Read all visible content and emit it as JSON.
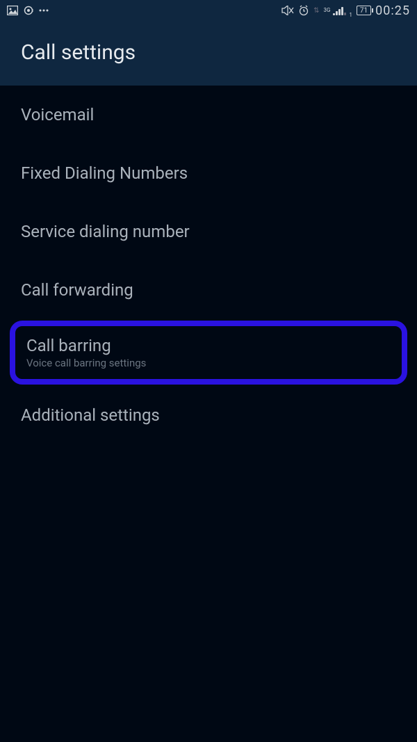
{
  "status_bar": {
    "battery_text": "71",
    "time": "00:25",
    "network_label": "3G"
  },
  "header": {
    "title": "Call settings"
  },
  "items": [
    {
      "title": "Voicemail"
    },
    {
      "title": "Fixed Dialing Numbers"
    },
    {
      "title": "Service dialing number"
    },
    {
      "title": "Call forwarding"
    },
    {
      "title": "Call barring",
      "subtitle": "Voice call barring settings",
      "highlighted": true
    },
    {
      "title": "Additional settings"
    }
  ],
  "highlight_color": "#2a12e0"
}
